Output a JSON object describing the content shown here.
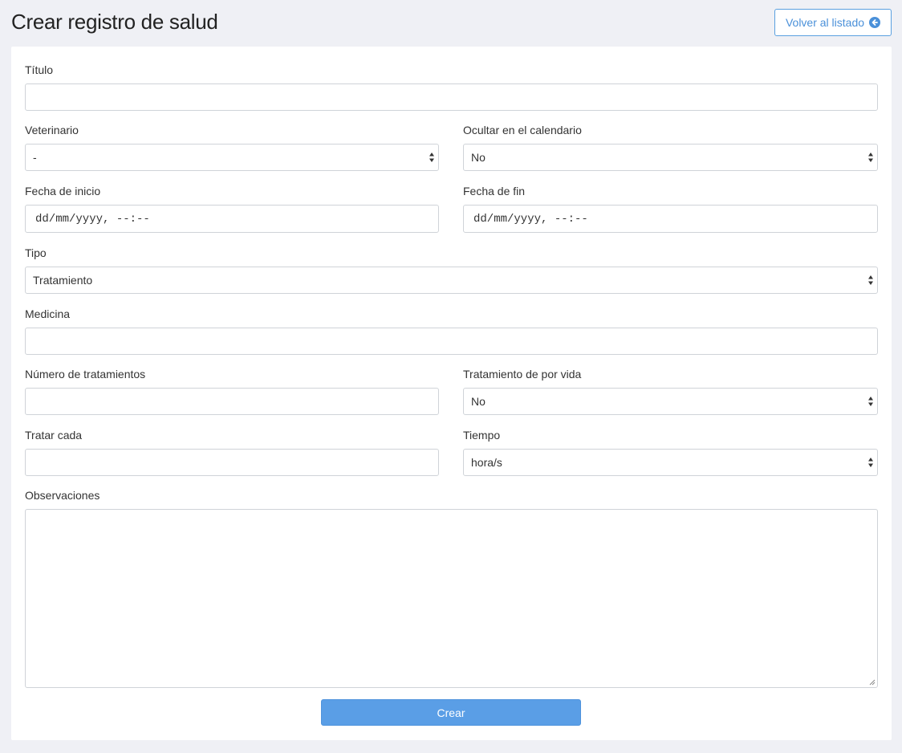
{
  "header": {
    "title": "Crear registro de salud",
    "back_label": "Volver al listado",
    "back_icon": "arrow-circle-left-icon"
  },
  "form": {
    "titulo": {
      "label": "Título",
      "value": ""
    },
    "veterinario": {
      "label": "Veterinario",
      "selected": "-"
    },
    "ocultar": {
      "label": "Ocultar en el calendario",
      "selected": "No"
    },
    "fecha_inicio": {
      "label": "Fecha de inicio",
      "value": "dd/mm/yyyy, --:--"
    },
    "fecha_fin": {
      "label": "Fecha de fin",
      "value": "dd/mm/yyyy, --:--"
    },
    "tipo": {
      "label": "Tipo",
      "selected": "Tratamiento"
    },
    "medicina": {
      "label": "Medicina",
      "value": ""
    },
    "numero_tratamientos": {
      "label": "Número de tratamientos",
      "value": ""
    },
    "tratamiento_vida": {
      "label": "Tratamiento de por vida",
      "selected": "No"
    },
    "tratar_cada": {
      "label": "Tratar cada",
      "value": ""
    },
    "tiempo": {
      "label": "Tiempo",
      "selected": "hora/s"
    },
    "observaciones": {
      "label": "Observaciones",
      "value": ""
    },
    "submit_label": "Crear"
  },
  "colors": {
    "background": "#eff0f5",
    "accent": "#5a9ee6",
    "link": "#4a90d9"
  }
}
